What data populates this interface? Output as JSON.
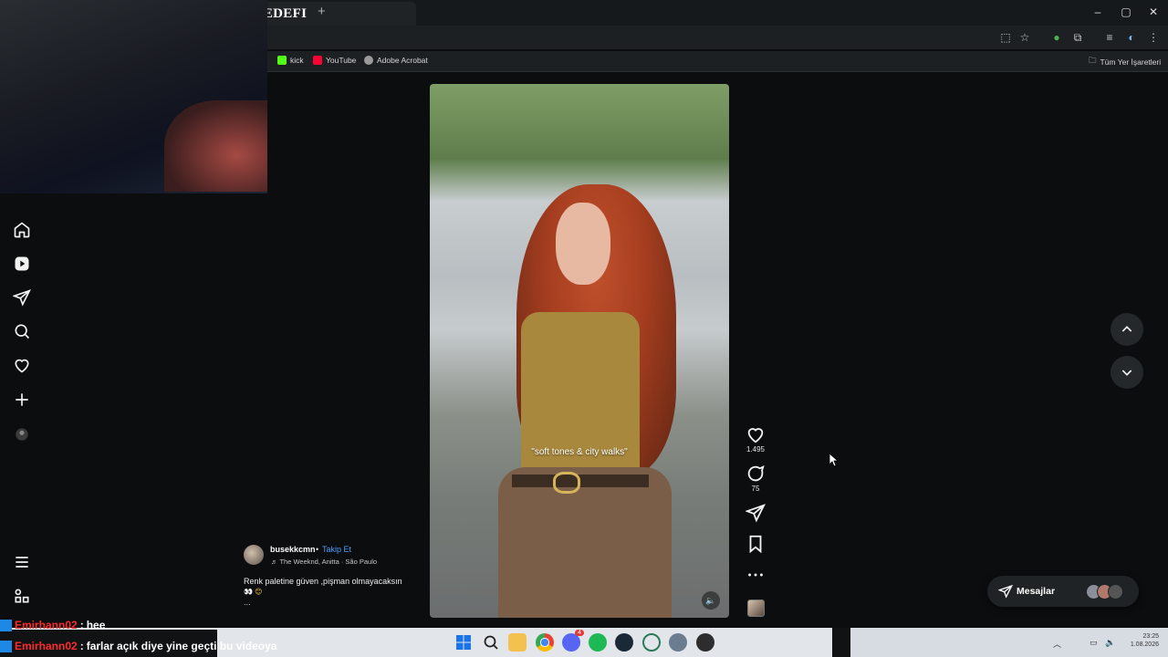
{
  "browser": {
    "tab_title": "ABONE HEDEFI",
    "tab_left_glyph": "D",
    "new_tab": "+",
    "window_controls": [
      "–",
      "▢",
      "✕"
    ],
    "bookmarks": [
      {
        "label": "kick",
        "color": "#53fc18"
      },
      {
        "label": "YouTube",
        "color": "#ff0033"
      },
      {
        "label": "Adobe Acrobat",
        "color": "#9a9a9a"
      }
    ],
    "all_bookmarks": "Tüm Yer İşaretleri"
  },
  "nav": {
    "icons": [
      "home-icon",
      "reels-icon",
      "direct-icon",
      "search-icon",
      "heart-icon",
      "create-icon",
      "profile-avatar",
      "menu-icon",
      "more-apps-icon"
    ]
  },
  "reel": {
    "overlay_text": "\"soft tones & city walks\"",
    "likes": "1.495",
    "comments": "75",
    "username": "busekkcmn",
    "separator": "•",
    "follow": "Takip Et",
    "music": "♬ The Weeknd, Anitta · São Paulo",
    "caption": "Renk paletine güven ,pişman olmayacaksın",
    "caption_emoji": "👀 😊",
    "caption_more": "...",
    "accent": "#4a9ef5"
  },
  "messages": {
    "label": "Mesajlar"
  },
  "chat": [
    {
      "user": "Emirhann02",
      "sep": ":",
      "message": "hee"
    },
    {
      "user": "Emirhann02",
      "sep": ":",
      "message": "farlar açık diye yine geçti bu videoya"
    }
  ],
  "taskbar": {
    "apps": [
      "windows-start-icon",
      "search-icon",
      "file-explorer-icon",
      "chrome-icon",
      "discord-icon",
      "spotify-icon",
      "steam-icon",
      "link-app-icon",
      "settings-gear-icon",
      "obs-icon"
    ],
    "discord_badge": "4",
    "time": "23:25",
    "date": "1.08.2026"
  }
}
